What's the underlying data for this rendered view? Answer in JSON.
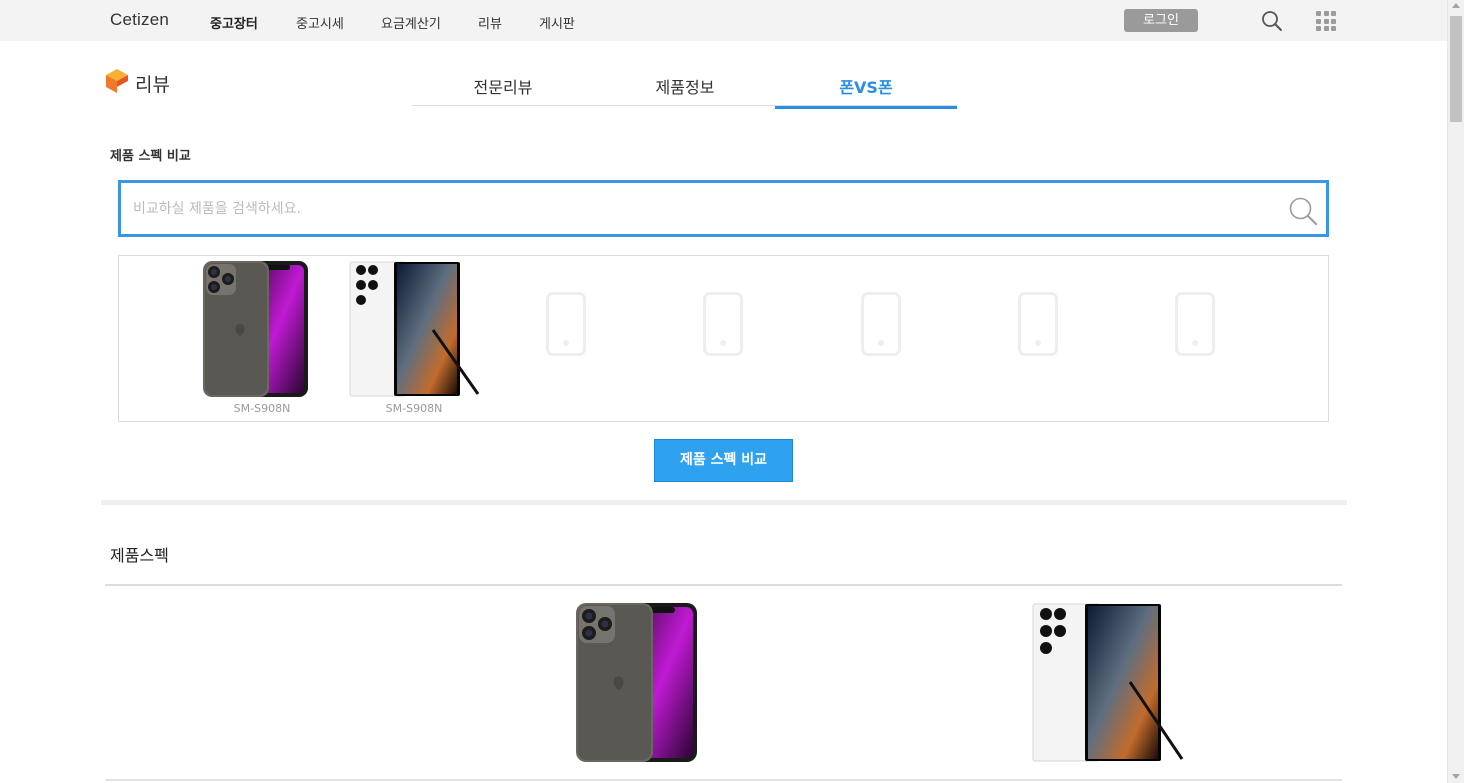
{
  "topnav": {
    "logo": "Cetizen",
    "items": [
      {
        "label": "중고장터",
        "bold": true
      },
      {
        "label": "중고시세",
        "bold": false
      },
      {
        "label": "요금계산기",
        "bold": false
      },
      {
        "label": "리뷰",
        "bold": false
      },
      {
        "label": "게시판",
        "bold": false
      }
    ],
    "login_label": "로그인",
    "search_icon": "search-icon",
    "apps_icon": "apps-grid-icon"
  },
  "section": {
    "title": "리뷰",
    "tabs": [
      {
        "label": "전문리뷰",
        "active": false
      },
      {
        "label": "제품정보",
        "active": false
      },
      {
        "label": "폰VS폰",
        "active": true
      }
    ]
  },
  "compare": {
    "label": "제품 스펙 비교",
    "search_placeholder": "비교하실 제품을 검색하세요.",
    "search_value": "",
    "slots": [
      {
        "caption": "SM-S908N",
        "filled": true,
        "device": "iphone"
      },
      {
        "caption": "SM-S908N",
        "filled": true,
        "device": "galaxy"
      },
      {
        "caption": "",
        "filled": false
      },
      {
        "caption": "",
        "filled": false
      },
      {
        "caption": "",
        "filled": false
      },
      {
        "caption": "",
        "filled": false
      },
      {
        "caption": "",
        "filled": false
      }
    ],
    "button_label": "제품 스펙 비교"
  },
  "specs": {
    "title": "제품스펙"
  },
  "colors": {
    "accent": "#2b8ee6",
    "button": "#2ea1ef",
    "search_border": "#3a95e4",
    "login_bg": "#9a9a9a"
  }
}
